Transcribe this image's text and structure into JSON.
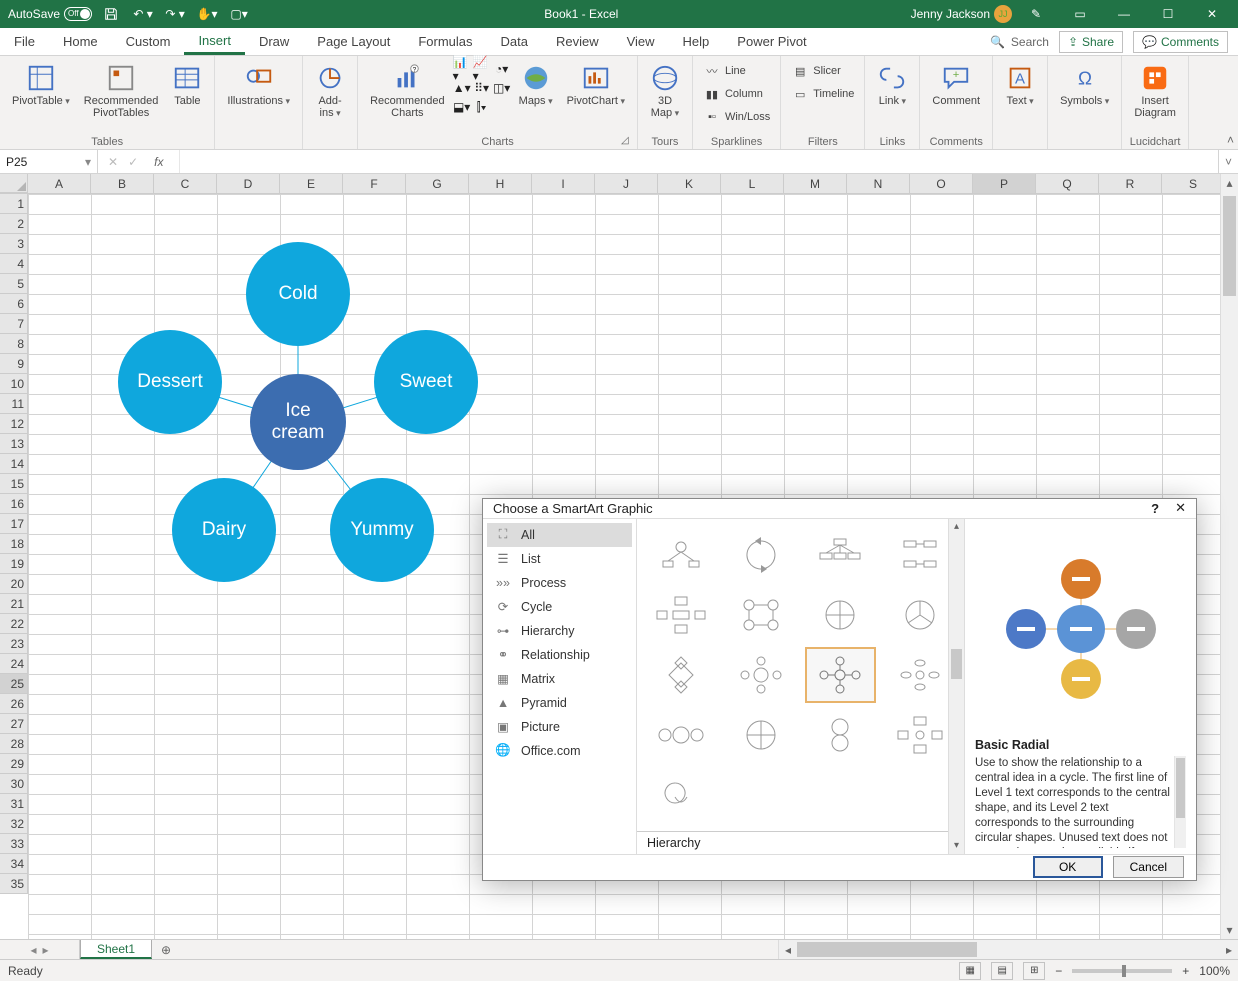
{
  "titlebar": {
    "autosave_label": "AutoSave",
    "autosave_state": "Off",
    "document_title": "Book1 - Excel",
    "user_name": "Jenny Jackson",
    "user_initials": "JJ"
  },
  "ribbon": {
    "tabs": [
      "File",
      "Home",
      "Custom",
      "Insert",
      "Draw",
      "Page Layout",
      "Formulas",
      "Data",
      "Review",
      "View",
      "Help",
      "Power Pivot"
    ],
    "active_tab": "Insert",
    "search_placeholder": "Search",
    "share_label": "Share",
    "comments_label": "Comments",
    "groups": {
      "tables": {
        "label": "Tables",
        "pivot": "PivotTable",
        "recommended": "Recommended\nPivotTables",
        "table": "Table"
      },
      "illustrations": {
        "label": "Illustrations",
        "btn": "Illustrations"
      },
      "addins": {
        "label": "Add-ins",
        "btn": "Add-\nins"
      },
      "charts": {
        "label": "Charts",
        "recommended": "Recommended\nCharts",
        "maps": "Maps",
        "pivotchart": "PivotChart"
      },
      "tours": {
        "label": "Tours",
        "map3d": "3D\nMap"
      },
      "sparklines": {
        "label": "Sparklines",
        "line": "Line",
        "column": "Column",
        "winloss": "Win/Loss"
      },
      "filters": {
        "label": "Filters",
        "slicer": "Slicer",
        "timeline": "Timeline"
      },
      "links": {
        "label": "Links",
        "link": "Link"
      },
      "comments": {
        "label": "Comments",
        "comment": "Comment"
      },
      "text": {
        "label": "Text",
        "btn": "Text"
      },
      "symbols": {
        "label": "Symbols",
        "btn": "Symbols"
      },
      "lucid": {
        "label": "Lucidchart",
        "btn": "Insert\nDiagram"
      }
    }
  },
  "namebox": {
    "value": "P25"
  },
  "columns": [
    "A",
    "B",
    "C",
    "D",
    "E",
    "F",
    "G",
    "H",
    "I",
    "J",
    "K",
    "L",
    "M",
    "N",
    "O",
    "P",
    "Q",
    "R",
    "S"
  ],
  "selected_col": "P",
  "rows_count": 35,
  "selected_row": 25,
  "smartart": {
    "center": "Ice\ncream",
    "nodes": [
      "Cold",
      "Sweet",
      "Yummy",
      "Dairy",
      "Dessert"
    ]
  },
  "dialog": {
    "title": "Choose a SmartArt Graphic",
    "categories": [
      "All",
      "List",
      "Process",
      "Cycle",
      "Hierarchy",
      "Relationship",
      "Matrix",
      "Pyramid",
      "Picture",
      "Office.com"
    ],
    "selected_category": "All",
    "gallery_section_label": "Hierarchy",
    "preview": {
      "title": "Basic Radial",
      "description": "Use to show the relationship to a central idea in a cycle. The first line of Level 1 text corresponds to the central shape, and its Level 2 text corresponds to the surrounding circular shapes. Unused text does not appear, but remains available if you switch"
    },
    "ok": "OK",
    "cancel": "Cancel"
  },
  "sheets": {
    "active": "Sheet1"
  },
  "status": {
    "ready": "Ready",
    "zoom": "100%"
  }
}
